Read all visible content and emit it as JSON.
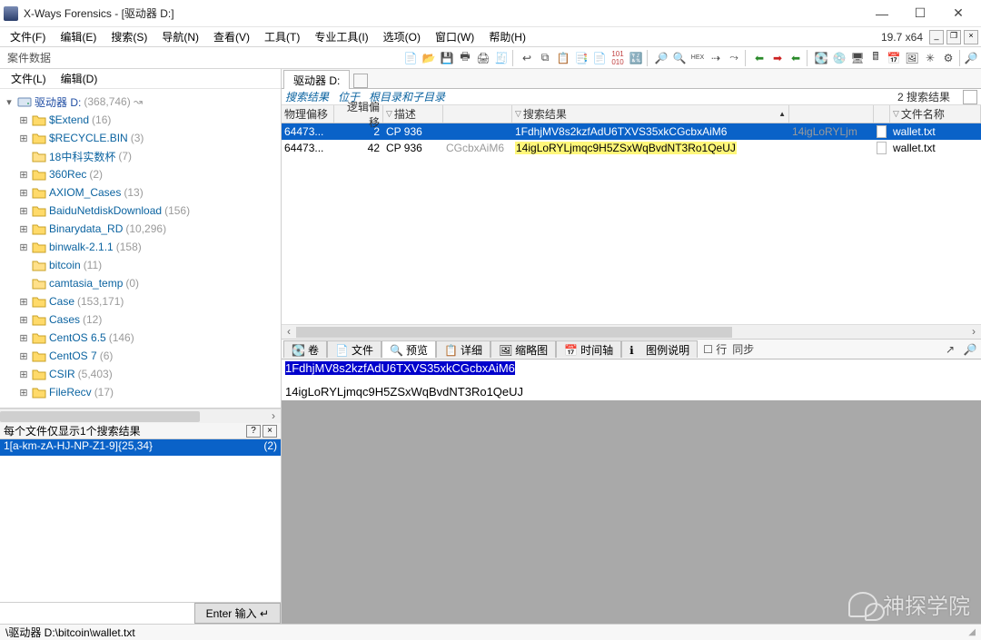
{
  "window": {
    "title": "X-Ways Forensics - [驱动器 D:]",
    "min": "—",
    "max": "☐",
    "close": "✕"
  },
  "menus": [
    "文件(F)",
    "编辑(E)",
    "搜索(S)",
    "导航(N)",
    "查看(V)",
    "工具(T)",
    "专业工具(I)",
    "选项(O)",
    "窗口(W)",
    "帮助(H)"
  ],
  "version": "19.7 x64",
  "left_panel_title": "案件数据",
  "left_menus": [
    "文件(L)",
    "编辑(D)"
  ],
  "tree": {
    "root": {
      "name": "驱动器 D:",
      "count": "(368,746)"
    },
    "items": [
      {
        "name": "$Extend",
        "count": "(16)",
        "exp": "+"
      },
      {
        "name": "$RECYCLE.BIN",
        "count": "(3)",
        "exp": "+"
      },
      {
        "name": "18中科实数杯",
        "count": "(7)",
        "exp": ""
      },
      {
        "name": "360Rec",
        "count": "(2)",
        "exp": "+"
      },
      {
        "name": "AXIOM_Cases",
        "count": "(13)",
        "exp": "+"
      },
      {
        "name": "BaiduNetdiskDownload",
        "count": "(156)",
        "exp": "+"
      },
      {
        "name": "Binarydata_RD",
        "count": "(10,296)",
        "exp": "+"
      },
      {
        "name": "binwalk-2.1.1",
        "count": "(158)",
        "exp": "+"
      },
      {
        "name": "bitcoin",
        "count": "(11)",
        "exp": ""
      },
      {
        "name": "camtasia_temp",
        "count": "(0)",
        "exp": ""
      },
      {
        "name": "Case",
        "count": "(153,171)",
        "exp": "+"
      },
      {
        "name": "Cases",
        "count": "(12)",
        "exp": "+"
      },
      {
        "name": "CentOS 6.5",
        "count": "(146)",
        "exp": "+"
      },
      {
        "name": "CentOS 7",
        "count": "(6)",
        "exp": "+"
      },
      {
        "name": "CSIR",
        "count": "(5,403)",
        "exp": "+"
      },
      {
        "name": "FileRecv",
        "count": "(17)",
        "exp": "+"
      }
    ]
  },
  "search_panel": {
    "header": "每个文件仅显示1个搜索结果",
    "row": "1[a-km-zA-HJ-NP-Z1-9]{25,34}",
    "row_count": "(2)"
  },
  "enter_btn": "Enter 输入 ↵",
  "right_tab": "驱动器 D:",
  "crumbs": [
    "搜索结果",
    "位于",
    "根目录和子目录"
  ],
  "result_summary": "2 搜索结果",
  "columns": {
    "po": "物理偏移",
    "lo": "逻辑偏移",
    "desc": "描述",
    "sr": "搜索结果",
    "fn": "文件名称"
  },
  "rows": [
    {
      "po": "64473...",
      "lo": "2",
      "desc": "CP 936",
      "ctx": "",
      "hit": "1FdhjMV8s2kzfAdU6TXVS35xkCGcbxAiM6",
      "tail": "14igLoRYLjm",
      "fn": "wallet.txt",
      "sel": true
    },
    {
      "po": "64473...",
      "lo": "42",
      "desc": "CP 936",
      "ctx": "CGcbxAiM6",
      "hit": "14igLoRYLjmqc9H5ZSxWqBvdNT3Ro1QeUJ",
      "tail": "",
      "fn": "wallet.txt",
      "sel": false
    }
  ],
  "lowtabs": [
    "卷",
    "文件",
    "预览",
    "详细",
    "缩略图",
    "时间轴",
    "图例说明",
    "行",
    "同步"
  ],
  "preview": {
    "line1": "1FdhjMV8s2kzfAdU6TXVS35xkCGcbxAiM6",
    "line2": "14igLoRYLjmqc9H5ZSxWqBvdNT3Ro1QeUJ"
  },
  "status_path": "\\驱动器 D:\\bitcoin\\wallet.txt",
  "watermark": "神探学院"
}
